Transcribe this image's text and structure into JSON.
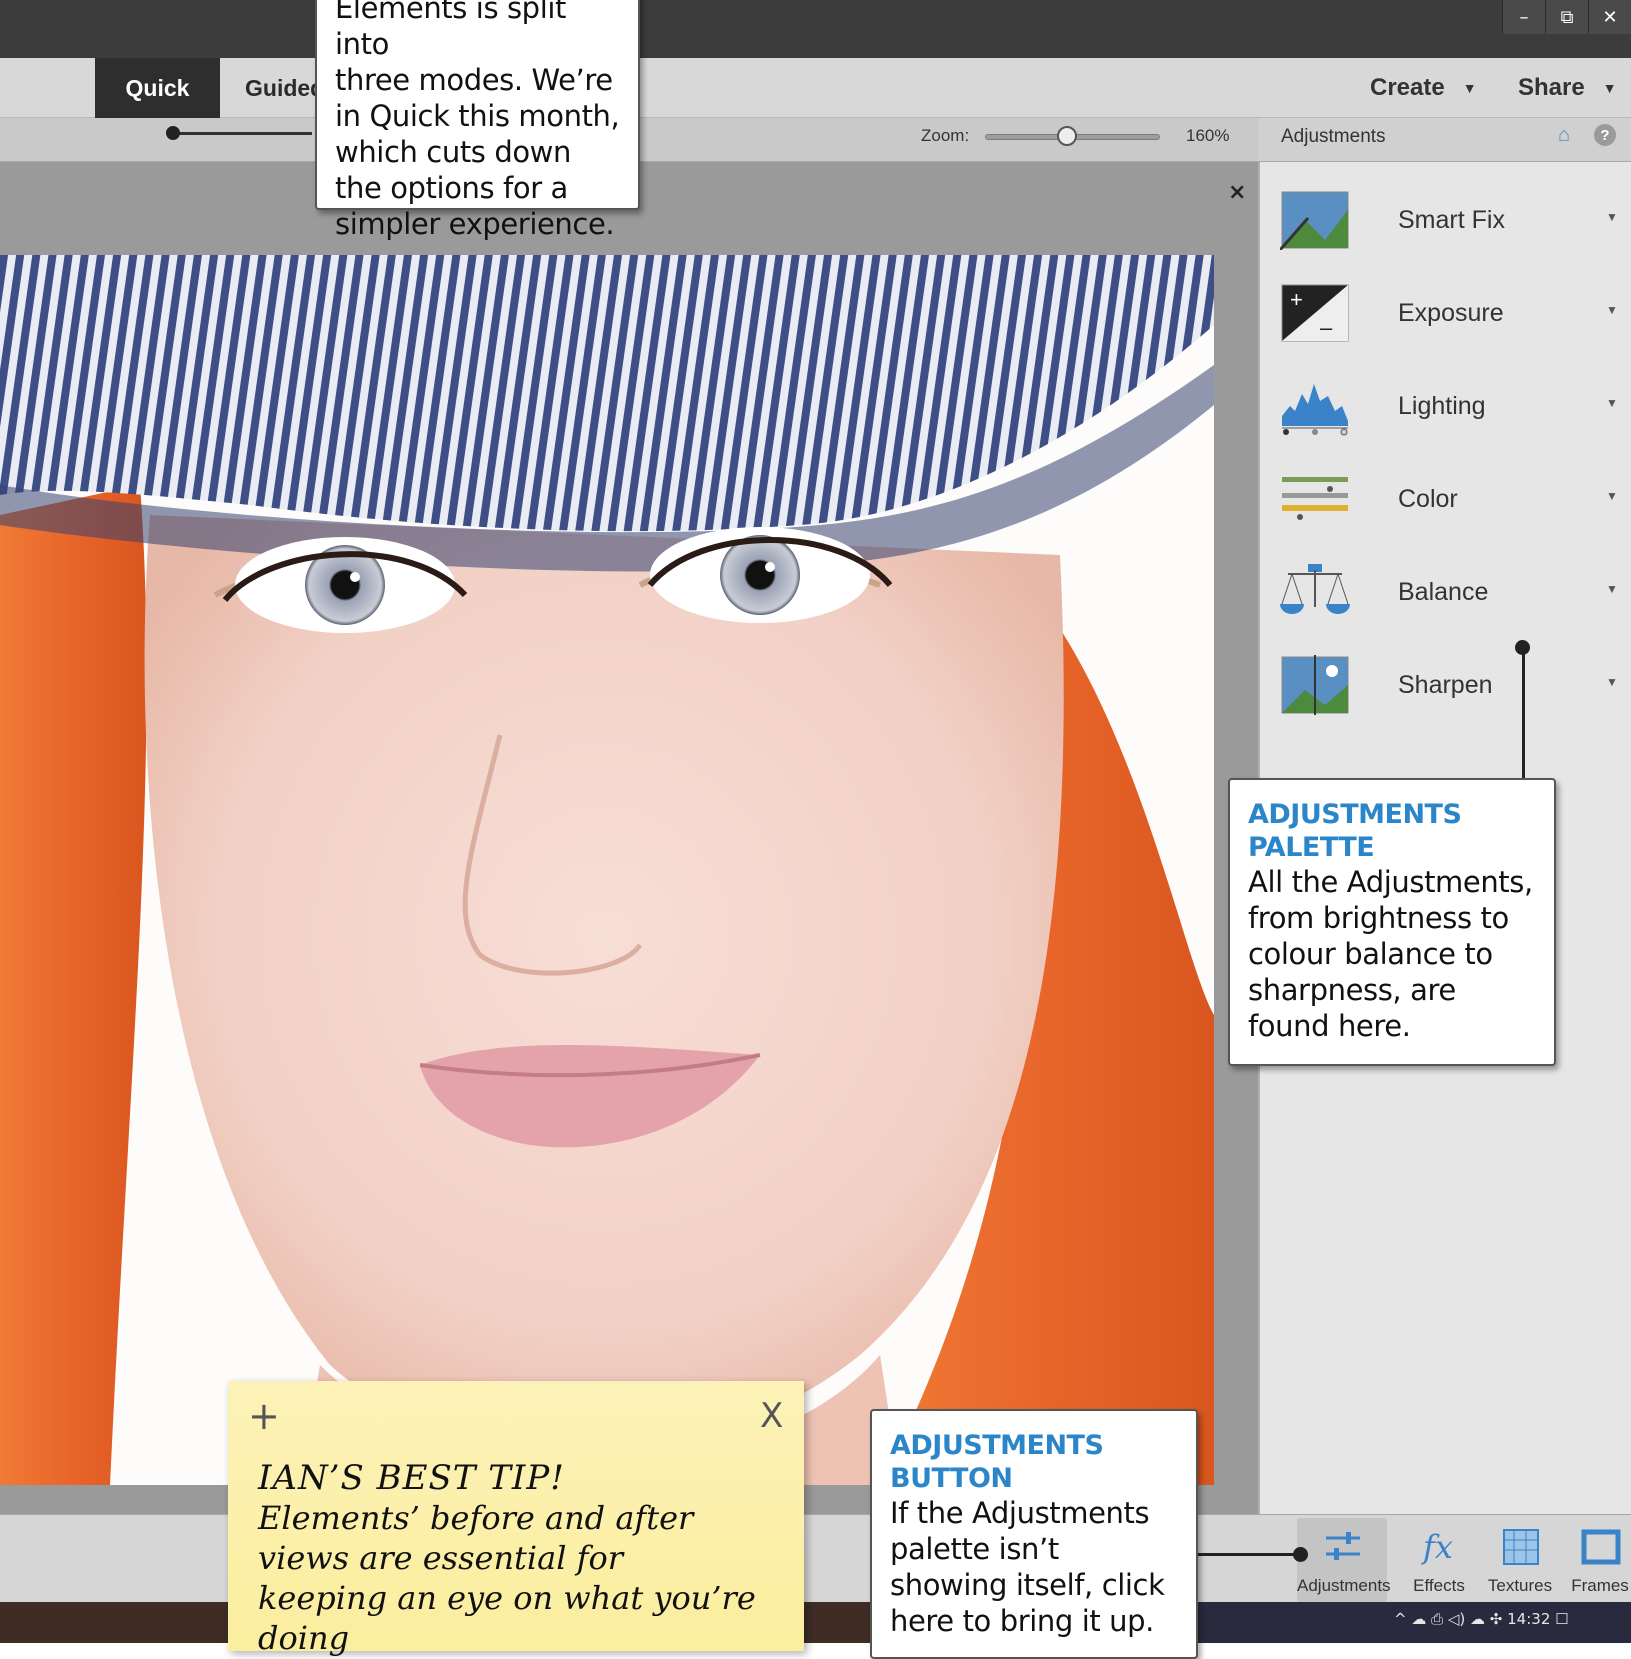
{
  "window": {
    "controls": [
      "–",
      "⧉",
      "✕"
    ]
  },
  "modebar": {
    "tabs": [
      {
        "label": "Quick",
        "active": true
      },
      {
        "label": "Guided",
        "active": false
      }
    ],
    "create_label": "Create",
    "share_label": "Share"
  },
  "options": {
    "zoom_label": "Zoom:",
    "zoom_value": "160%",
    "zoom_slider_fraction": 0.47
  },
  "canvas": {
    "close_glyph": "×"
  },
  "panel": {
    "title": "Adjustments",
    "items": [
      {
        "label": "Smart Fix",
        "icon": "smart-fix-icon"
      },
      {
        "label": "Exposure",
        "icon": "exposure-icon"
      },
      {
        "label": "Lighting",
        "icon": "lighting-icon"
      },
      {
        "label": "Color",
        "icon": "color-icon"
      },
      {
        "label": "Balance",
        "icon": "balance-icon"
      },
      {
        "label": "Sharpen",
        "icon": "sharpen-icon"
      }
    ]
  },
  "bottombar": {
    "buttons": [
      {
        "label": "Adjustments",
        "icon": "adjustments-icon"
      },
      {
        "label": "Effects",
        "icon": "fx-icon"
      },
      {
        "label": "Textures",
        "icon": "textures-icon"
      },
      {
        "label": "Frames",
        "icon": "frames-icon"
      }
    ],
    "clock": "14:32"
  },
  "callouts": {
    "modes": {
      "lines": [
        "Elements is split into",
        "three modes. We’re",
        "in Quick this month,",
        "which cuts down",
        "the options for a",
        "simpler experience."
      ]
    },
    "adjustments_palette": {
      "title_lines": [
        "ADJUSTMENTS",
        "PALETTE"
      ],
      "body": "All the Adjustments, from brightness to colour balance to sharpness, are found here."
    },
    "adjustments_button": {
      "title_lines": [
        "ADJUSTMENTS",
        "BUTTON"
      ],
      "body": "If the Adjustments palette isn’t showing itself, click here to bring it up."
    }
  },
  "sticky_note": {
    "plus": "+",
    "close": "X",
    "title": "IAN’S BEST TIP!",
    "body": "Elements’ before and after views are essential for keeping an eye on what you’re doing"
  },
  "colors": {
    "accent_blue": "#2b86c9",
    "hair": "#e8652a",
    "cap": "#3e4f86"
  }
}
